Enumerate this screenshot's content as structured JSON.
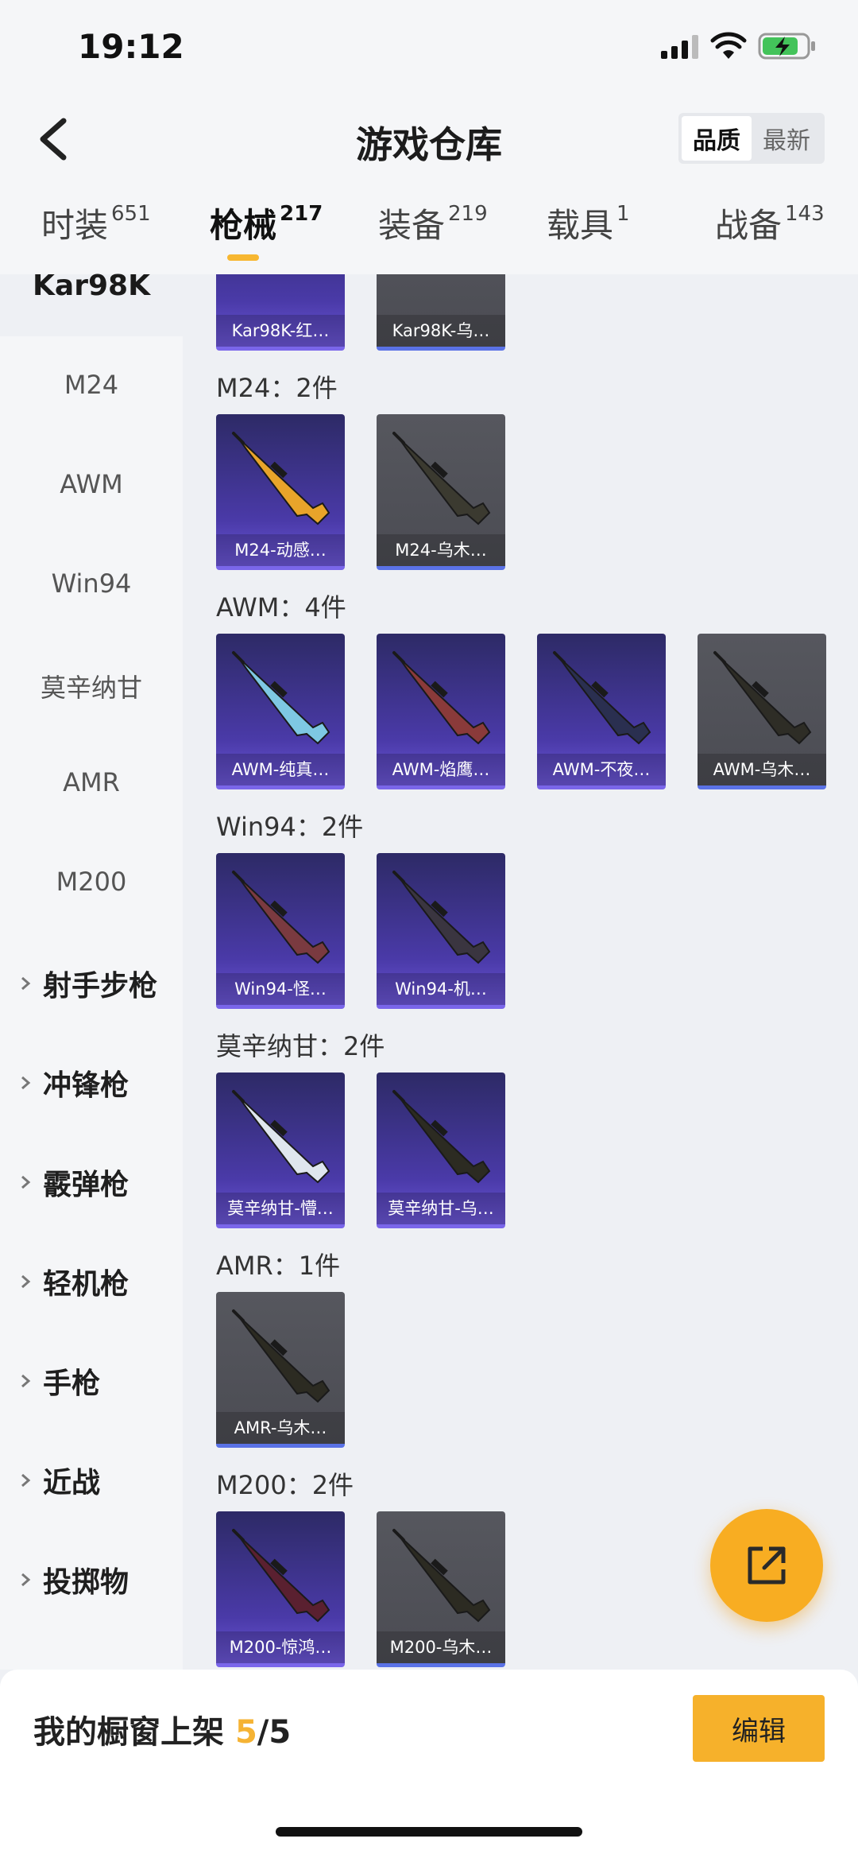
{
  "status_bar": {
    "time": "19:12"
  },
  "header": {
    "title": "游戏仓库",
    "sort_options": [
      "品质",
      "最新"
    ],
    "tabs": [
      {
        "label": "时装",
        "count": "651"
      },
      {
        "label": "枪械",
        "count": "217"
      },
      {
        "label": "装备",
        "count": "219"
      },
      {
        "label": "载具",
        "count": "1"
      },
      {
        "label": "战备",
        "count": "143"
      }
    ]
  },
  "sidebar": {
    "selected": "Kar98K",
    "sub_items": [
      "M24",
      "AWM",
      "Win94",
      "莫辛纳甘",
      "AMR",
      "M200"
    ],
    "categories": [
      "射手步枪",
      "冲锋枪",
      "霰弹枪",
      "轻机枪",
      "手枪",
      "近战",
      "投掷物"
    ]
  },
  "content": {
    "top_cards": [
      {
        "label": "Kar98K-红…",
        "style": "purple"
      },
      {
        "label": "Kar98K-乌…",
        "style": "gray"
      }
    ],
    "sections": [
      {
        "title": "M24：2件",
        "items": [
          {
            "label": "M24-动感…",
            "style": "purple",
            "color": "#e8a42a"
          },
          {
            "label": "M24-乌木…",
            "style": "gray",
            "color": "#3b3a30"
          }
        ]
      },
      {
        "title": "AWM：4件",
        "items": [
          {
            "label": "AWM-纯真…",
            "style": "purple",
            "color": "#7ec8e3"
          },
          {
            "label": "AWM-焰鹰…",
            "style": "purple",
            "color": "#8a3a3a"
          },
          {
            "label": "AWM-不夜…",
            "style": "purple",
            "color": "#2a2f50"
          },
          {
            "label": "AWM-乌木…",
            "style": "gray",
            "color": "#2e2d26"
          }
        ]
      },
      {
        "title": "Win94：2件",
        "items": [
          {
            "label": "Win94-怪…",
            "style": "purple",
            "color": "#7a3a40"
          },
          {
            "label": "Win94-机…",
            "style": "purple",
            "color": "#3a3540"
          }
        ]
      },
      {
        "title": "莫辛纳甘：2件",
        "items": [
          {
            "label": "莫辛纳甘-懵…",
            "style": "purple",
            "color": "#dfe6ee"
          },
          {
            "label": "莫辛纳甘-乌…",
            "style": "purple",
            "color": "#2c2b22"
          }
        ]
      },
      {
        "title": "AMR：1件",
        "items": [
          {
            "label": "AMR-乌木…",
            "style": "gray",
            "color": "#2c2b22"
          }
        ]
      },
      {
        "title": "M200：2件",
        "items": [
          {
            "label": "M200-惊鸿…",
            "style": "purple",
            "color": "#5a2030"
          },
          {
            "label": "M200-乌木…",
            "style": "gray",
            "color": "#2c2b22"
          }
        ]
      }
    ]
  },
  "footer": {
    "showcase_label": "我的橱窗上架",
    "showcase_current": "5",
    "showcase_total": "/5",
    "edit_label": "编辑"
  },
  "colors": {
    "accent": "#f7b731",
    "card_purple": "#4a3aa8",
    "card_gray": "#55565d"
  },
  "icons": [
    "back-chevron-icon",
    "signal-icon",
    "wifi-icon",
    "battery-icon",
    "share-icon",
    "chevron-right-icon"
  ]
}
